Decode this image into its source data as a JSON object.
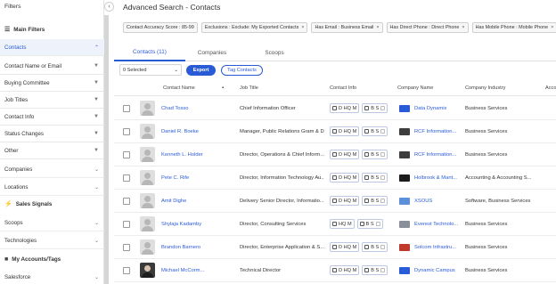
{
  "sidebar": {
    "title": "Filters",
    "main_filters_label": "Main Filters",
    "contacts_label": "Contacts",
    "contact_items": [
      {
        "label": "Contact Name or Email"
      },
      {
        "label": "Buying Committee"
      },
      {
        "label": "Job Titles"
      },
      {
        "label": "Contact Info"
      },
      {
        "label": "Status Changes"
      },
      {
        "label": "Other"
      }
    ],
    "companies_label": "Companies",
    "locations_label": "Locations",
    "sales_signals_label": "Sales Signals",
    "scoops_label": "Scoops",
    "technologies_label": "Technologies",
    "my_accounts_label": "My Accounts/Tags",
    "salesforce_label": "Salesforce"
  },
  "header": {
    "title": "Advanced Search - Contacts"
  },
  "chips": [
    {
      "label": "Contact Accuracy Score : 85-99"
    },
    {
      "label": "Exclusions : Exclude: My Exported Contacts",
      "x": "×"
    },
    {
      "label": "Has Email : Business Email",
      "x": "×"
    },
    {
      "label": "Has Direct Phone : Direct Phone",
      "x": "×"
    },
    {
      "label": "Has Mobile Phone : Mobile Phone",
      "x": "×"
    }
  ],
  "tabs": [
    {
      "label": "Contacts (11)"
    },
    {
      "label": "Companies"
    },
    {
      "label": "Scoops"
    }
  ],
  "toolbar": {
    "selected": "0 Selected",
    "export_label": "Export",
    "tag_label": "Tag Contacts"
  },
  "columns": {
    "contact_name": "Contact Name",
    "job_title": "Job Title",
    "contact_info": "Contact Info",
    "company_name": "Company Name",
    "company_industry": "Company Industry",
    "extra": "Acco"
  },
  "pills": {
    "d": "D",
    "hq": "HQ",
    "m": "M",
    "b": "B",
    "s": "S"
  },
  "rows": [
    {
      "name": "Chad Tosso",
      "title": "Chief Information Officer",
      "company": "Data Dynamix",
      "industry": "Business Services",
      "logo_color": "#2a5bd7",
      "d": true
    },
    {
      "name": "Daniel R. Boeke",
      "title": "Manager, Public Relations Gram & D...",
      "company": "RCF Information...",
      "industry": "Business Services",
      "logo_color": "#3d3d3d",
      "d": true
    },
    {
      "name": "Kenneth L. Holder",
      "title": "Director, Operations & Chief Inform...",
      "company": "RCF Information...",
      "industry": "Business Services",
      "logo_color": "#3d3d3d",
      "d": true
    },
    {
      "name": "Pete C. Rife",
      "title": "Director, Information Technology Au...",
      "company": "Holbrook & Mant...",
      "industry": "Accounting & Accounting S...",
      "logo_color": "#1c1c1c",
      "d": true
    },
    {
      "name": "Amit Dighe",
      "title": "Delivery Senior Director, Informatio...",
      "company": "XSOUS",
      "industry": "Software, Business Services",
      "logo_color": "#5b8fd9",
      "d": true
    },
    {
      "name": "Shylaja Kadamby",
      "title": "Director, Consulting Services",
      "company": "Everest Technolo...",
      "industry": "Business Services",
      "logo_color": "#8a8f99",
      "d": false
    },
    {
      "name": "Brandon Barnero",
      "title": "Director, Enterprise Application & S...",
      "company": "Solcom Infrastru...",
      "industry": "Business Services",
      "logo_color": "#c0392b",
      "d": true
    },
    {
      "name": "Michael McCorm...",
      "title": "Technical Director",
      "company": "Dynamic Campus",
      "industry": "Business Services",
      "logo_color": "#2a5bd7",
      "d": true
    }
  ]
}
